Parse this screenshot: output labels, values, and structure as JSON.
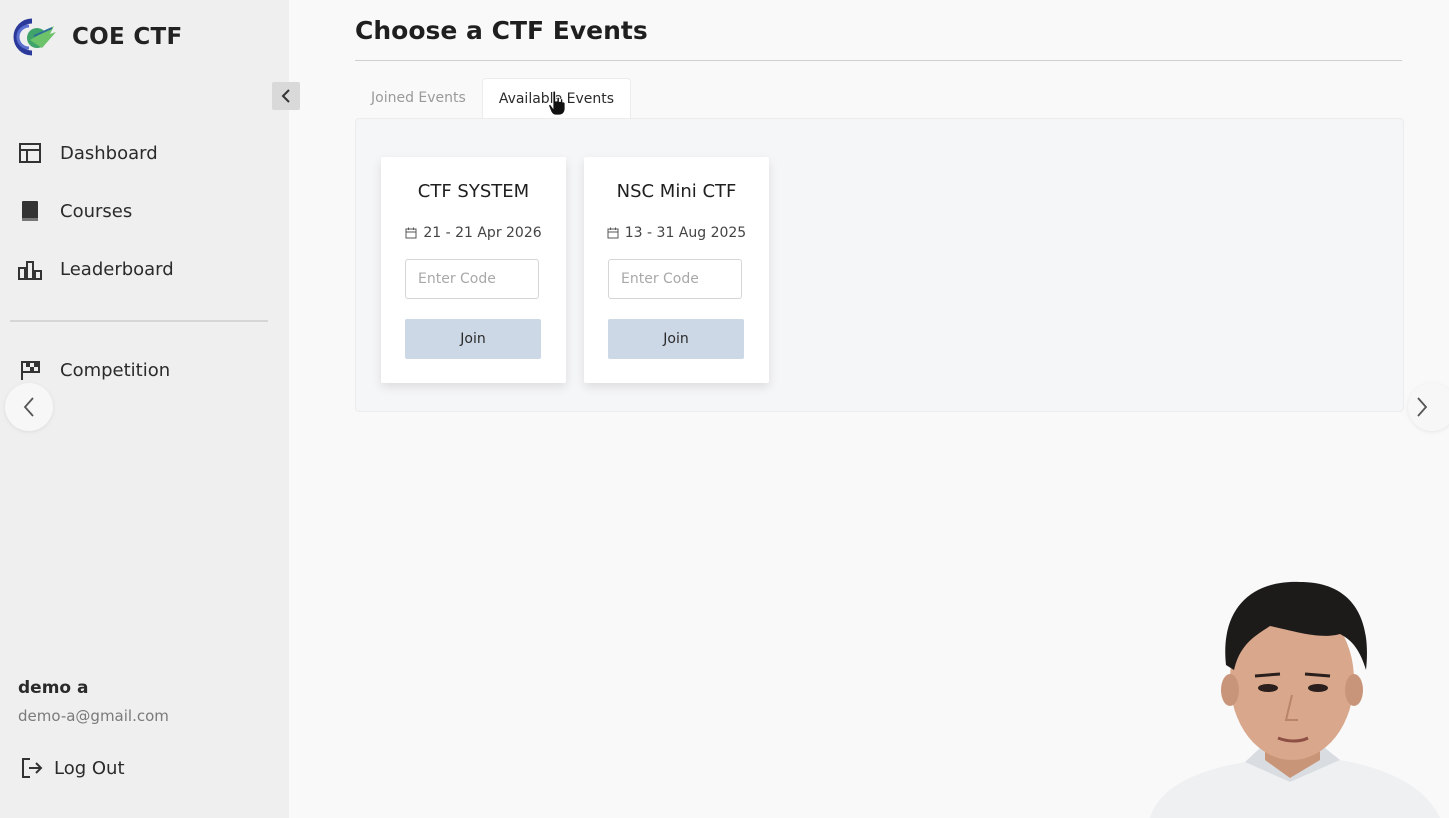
{
  "brand": {
    "name": "COE CTF"
  },
  "sidebar": {
    "items": [
      {
        "label": "Dashboard",
        "icon": "dashboard-icon"
      },
      {
        "label": "Courses",
        "icon": "book-icon"
      },
      {
        "label": "Leaderboard",
        "icon": "leaderboard-icon"
      }
    ],
    "competition": {
      "label": "Competition",
      "icon": "flag-icon"
    },
    "user": {
      "name": "demo a",
      "email": "demo-a@gmail.com"
    },
    "logout_label": "Log Out"
  },
  "main": {
    "title": "Choose a CTF Events",
    "tabs": [
      {
        "label": "Joined Events",
        "active": false
      },
      {
        "label": "Available Events",
        "active": true
      }
    ],
    "events": [
      {
        "name": "CTF SYSTEM",
        "dates": "21 - 21 Apr 2026",
        "code_placeholder": "Enter Code",
        "join_label": "Join"
      },
      {
        "name": "NSC Mini CTF",
        "dates": "13 - 31 Aug 2025",
        "code_placeholder": "Enter Code",
        "join_label": "Join"
      }
    ]
  },
  "colors": {
    "sidebar_bg": "#efefef",
    "page_bg": "#f9f9f9",
    "join_button": "#cdd8e6"
  }
}
